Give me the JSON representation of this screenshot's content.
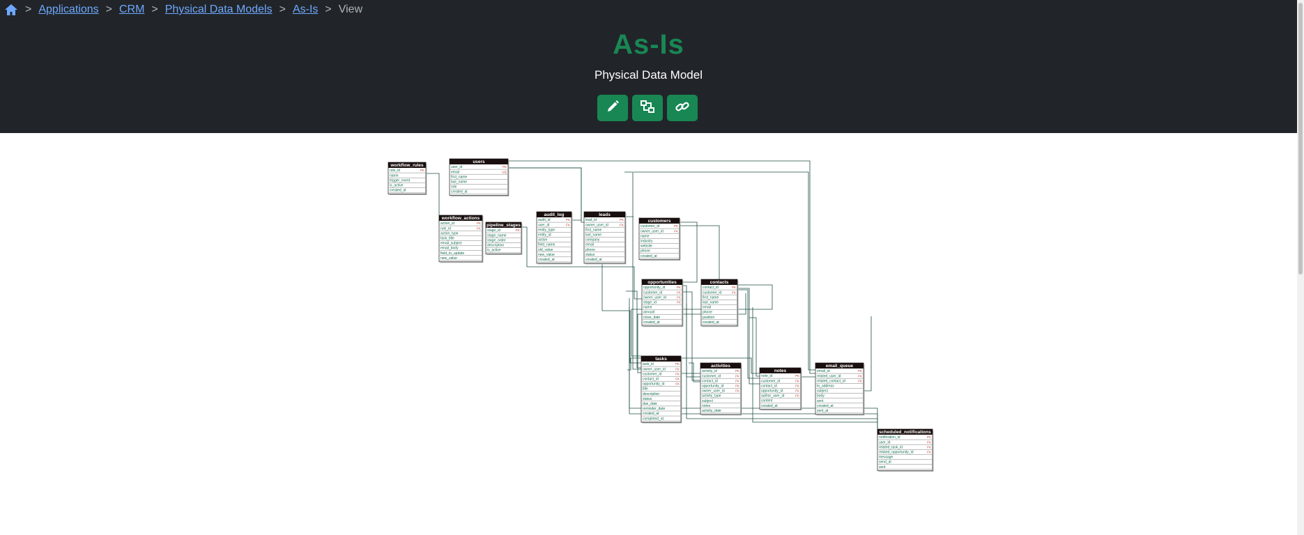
{
  "breadcrumb": {
    "home_icon": "home-icon",
    "items": [
      "Applications",
      "CRM",
      "Physical Data Models",
      "As-Is"
    ],
    "current": "View",
    "separator": ">"
  },
  "page": {
    "title": "As-Is",
    "subtitle": "Physical Data Model"
  },
  "actions": [
    {
      "icon": "pencil-icon",
      "name": "edit-button"
    },
    {
      "icon": "diagram-icon",
      "name": "diagram-button"
    },
    {
      "icon": "link-icon",
      "name": "link-button"
    }
  ],
  "colors": {
    "header_bg": "#212529",
    "accent": "#198754",
    "link": "#6ea8fe",
    "table_header": "#1a0f0f",
    "field_text": "#0f6b4f",
    "key_text": "#c0392b",
    "edge": "#1d4f44"
  },
  "diagram": {
    "tables": [
      {
        "name": "workflow_rules",
        "fields": [
          [
            "rule_id",
            "PK"
          ],
          [
            "name",
            ""
          ],
          [
            "trigger_event",
            ""
          ],
          [
            "is_active",
            ""
          ],
          [
            "created_at",
            ""
          ]
        ]
      },
      {
        "name": "users",
        "fields": [
          [
            "user_id",
            "PK"
          ],
          [
            "email",
            "UQ"
          ],
          [
            "first_name",
            ""
          ],
          [
            "last_name",
            ""
          ],
          [
            "role",
            ""
          ],
          [
            "created_at",
            ""
          ]
        ]
      },
      {
        "name": "workflow_actions",
        "fields": [
          [
            "action_id",
            "PK"
          ],
          [
            "rule_id",
            "FK"
          ],
          [
            "action_type",
            ""
          ],
          [
            "task_title",
            ""
          ],
          [
            "email_subject",
            ""
          ],
          [
            "email_body",
            ""
          ],
          [
            "field_to_update",
            ""
          ],
          [
            "new_value",
            ""
          ]
        ]
      },
      {
        "name": "pipeline_stages",
        "fields": [
          [
            "stage_id",
            "PK"
          ],
          [
            "stage_name",
            ""
          ],
          [
            "stage_order",
            ""
          ],
          [
            "description",
            ""
          ],
          [
            "is_active",
            ""
          ]
        ]
      },
      {
        "name": "audit_log",
        "fields": [
          [
            "audit_id",
            "PK"
          ],
          [
            "user_id",
            "FK"
          ],
          [
            "entity_type",
            ""
          ],
          [
            "entity_id",
            ""
          ],
          [
            "action",
            ""
          ],
          [
            "field_name",
            ""
          ],
          [
            "old_value",
            ""
          ],
          [
            "new_value",
            ""
          ],
          [
            "created_at",
            ""
          ]
        ]
      },
      {
        "name": "leads",
        "fields": [
          [
            "lead_id",
            "PK"
          ],
          [
            "owner_user_id",
            "FK"
          ],
          [
            "first_name",
            ""
          ],
          [
            "last_name",
            ""
          ],
          [
            "company",
            ""
          ],
          [
            "email",
            ""
          ],
          [
            "phone",
            ""
          ],
          [
            "status",
            ""
          ],
          [
            "created_at",
            ""
          ]
        ]
      },
      {
        "name": "customers",
        "fields": [
          [
            "customer_id",
            "PK"
          ],
          [
            "owner_user_id",
            "FK"
          ],
          [
            "name",
            ""
          ],
          [
            "industry",
            ""
          ],
          [
            "website",
            ""
          ],
          [
            "phone",
            ""
          ],
          [
            "created_at",
            ""
          ]
        ]
      },
      {
        "name": "opportunities",
        "fields": [
          [
            "opportunity_id",
            "PK"
          ],
          [
            "customer_id",
            "FK"
          ],
          [
            "owner_user_id",
            "FK"
          ],
          [
            "stage_id",
            "FK"
          ],
          [
            "name",
            ""
          ],
          [
            "amount",
            ""
          ],
          [
            "close_date",
            ""
          ],
          [
            "created_at",
            ""
          ]
        ]
      },
      {
        "name": "contacts",
        "fields": [
          [
            "contact_id",
            "PK"
          ],
          [
            "customer_id",
            "FK"
          ],
          [
            "first_name",
            ""
          ],
          [
            "last_name",
            ""
          ],
          [
            "email",
            ""
          ],
          [
            "phone",
            ""
          ],
          [
            "position",
            ""
          ],
          [
            "created_at",
            ""
          ]
        ]
      },
      {
        "name": "tasks",
        "fields": [
          [
            "task_id",
            "PK"
          ],
          [
            "owner_user_id",
            "FK"
          ],
          [
            "customer_id",
            "FK"
          ],
          [
            "contact_id",
            "FK"
          ],
          [
            "opportunity_id",
            "FK"
          ],
          [
            "title",
            ""
          ],
          [
            "description",
            ""
          ],
          [
            "status",
            ""
          ],
          [
            "due_date",
            ""
          ],
          [
            "reminder_date",
            ""
          ],
          [
            "created_at",
            ""
          ],
          [
            "completed_at",
            ""
          ]
        ]
      },
      {
        "name": "activities",
        "fields": [
          [
            "activity_id",
            "PK"
          ],
          [
            "customer_id",
            "FK"
          ],
          [
            "contact_id",
            "FK"
          ],
          [
            "opportunity_id",
            "FK"
          ],
          [
            "owner_user_id",
            "FK"
          ],
          [
            "activity_type",
            ""
          ],
          [
            "subject",
            ""
          ],
          [
            "notes",
            ""
          ],
          [
            "activity_date",
            ""
          ]
        ]
      },
      {
        "name": "notes",
        "fields": [
          [
            "note_id",
            "PK"
          ],
          [
            "customer_id",
            "FK"
          ],
          [
            "contact_id",
            "FK"
          ],
          [
            "opportunity_id",
            "FK"
          ],
          [
            "author_user_id",
            "FK"
          ],
          [
            "content",
            ""
          ],
          [
            "created_at",
            ""
          ]
        ]
      },
      {
        "name": "email_queue",
        "fields": [
          [
            "email_id",
            "PK"
          ],
          [
            "related_user_id",
            "FK"
          ],
          [
            "related_contact_id",
            "FK"
          ],
          [
            "to_address",
            ""
          ],
          [
            "subject",
            ""
          ],
          [
            "body",
            ""
          ],
          [
            "sent",
            ""
          ],
          [
            "created_at",
            ""
          ],
          [
            "sent_at",
            ""
          ]
        ]
      },
      {
        "name": "scheduled_notifications",
        "fields": [
          [
            "notification_id",
            "PK"
          ],
          [
            "user_id",
            "FK"
          ],
          [
            "related_task_id",
            "FK"
          ],
          [
            "related_opportunity_id",
            "FK"
          ],
          [
            "message",
            ""
          ],
          [
            "send_at",
            ""
          ],
          [
            "sent",
            ""
          ]
        ]
      }
    ]
  }
}
